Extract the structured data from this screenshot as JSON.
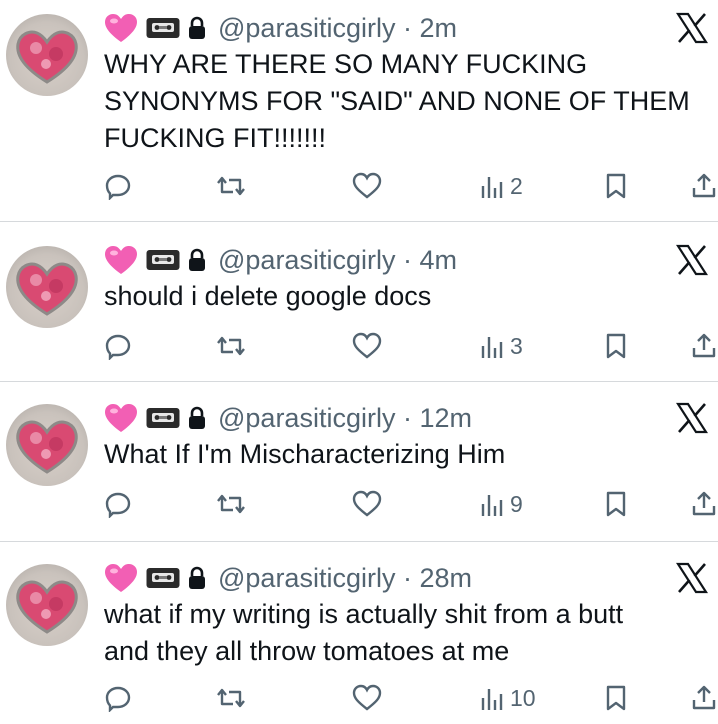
{
  "tweets": [
    {
      "handle": "@parasiticgirly",
      "separator": "·",
      "time": "2m",
      "text": "WHY ARE THERE SO MANY FUCKING\nSYNONYMS FOR \"SAID\" AND NONE OF THEM\nFUCKING FIT!!!!!!!",
      "views": "2"
    },
    {
      "handle": "@parasiticgirly",
      "separator": "·",
      "time": "4m",
      "text": "should i delete google docs",
      "views": "3"
    },
    {
      "handle": "@parasiticgirly",
      "separator": "·",
      "time": "12m",
      "text": "What If I'm Mischaracterizing Him",
      "views": "9"
    },
    {
      "handle": "@parasiticgirly",
      "separator": "·",
      "time": "28m",
      "text": "what if my writing is actually shit from a butt\nand they all throw tomatoes at me",
      "views": "10"
    }
  ],
  "icons": {
    "reply": "reply-icon",
    "retweet": "retweet-icon",
    "like": "heart-icon",
    "views": "views-icon",
    "bookmark": "bookmark-icon",
    "share": "share-icon",
    "platform": "x-logo-icon"
  },
  "colors": {
    "text": "#0f1419",
    "muted": "#536471",
    "divider": "#d6d9dc",
    "heart_emoji": "#f25fb4"
  }
}
